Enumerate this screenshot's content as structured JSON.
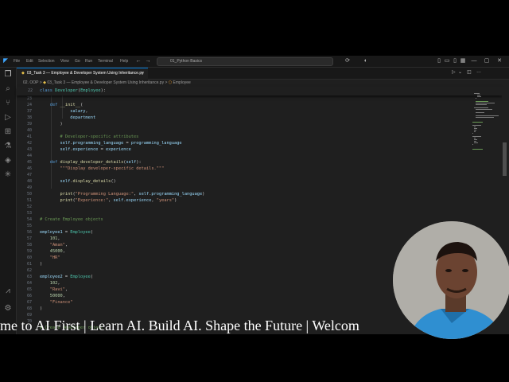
{
  "menu": [
    "File",
    "Edit",
    "Selection",
    "View",
    "Go",
    "Run",
    "Terminal",
    "Help"
  ],
  "search_text": "01_Python Basics",
  "tab": {
    "label": "03_Task 3 — Employee & Developer System Using Inheritance.py",
    "close": "×"
  },
  "breadcrumb": {
    "p1": "02. OOP",
    "sep": ">",
    "p2": "03_Task 3 — Employee & Developer System Using Inheritance.py",
    "p3": "Employee"
  },
  "sticky": {
    "ln": "22",
    "code": "class Developer(Employee):"
  },
  "lines": [
    {
      "n": "23",
      "t": ""
    },
    {
      "n": "24",
      "t": "    def __init__("
    },
    {
      "n": "37",
      "t": "            salary,"
    },
    {
      "n": "38",
      "t": "            department"
    },
    {
      "n": "39",
      "t": "        )"
    },
    {
      "n": "40",
      "t": ""
    },
    {
      "n": "41",
      "t": "        # Developer-specific attributes"
    },
    {
      "n": "42",
      "t": "        self.programming_language = programming_language"
    },
    {
      "n": "43",
      "t": "        self.experience = experience"
    },
    {
      "n": "44",
      "t": ""
    },
    {
      "n": "45",
      "t": "    def display_developer_details(self):"
    },
    {
      "n": "46",
      "t": "        \"\"\"Display developer-specific details.\"\"\""
    },
    {
      "n": "47",
      "t": ""
    },
    {
      "n": "48",
      "t": "        self.display_details()"
    },
    {
      "n": "49",
      "t": ""
    },
    {
      "n": "50",
      "t": "        print(\"Programming Language:\", self.programming_language)"
    },
    {
      "n": "51",
      "t": "        print(\"Experience:\", self.experience, \"years\")"
    },
    {
      "n": "52",
      "t": ""
    },
    {
      "n": "53",
      "t": ""
    },
    {
      "n": "54",
      "t": "# Create Employee objects"
    },
    {
      "n": "55",
      "t": ""
    },
    {
      "n": "56",
      "t": "employee1 = Employee("
    },
    {
      "n": "57",
      "t": "    101,"
    },
    {
      "n": "58",
      "t": "    \"Aman\","
    },
    {
      "n": "59",
      "t": "    45000,"
    },
    {
      "n": "60",
      "t": "    \"HR\""
    },
    {
      "n": "61",
      "t": ")"
    },
    {
      "n": "62",
      "t": ""
    },
    {
      "n": "63",
      "t": "employee2 = Employee("
    },
    {
      "n": "64",
      "t": "    102,"
    },
    {
      "n": "65",
      "t": "    \"Ravi\","
    },
    {
      "n": "66",
      "t": "    50000,"
    },
    {
      "n": "67",
      "t": "    \"Finance\""
    },
    {
      "n": "68",
      "t": ")"
    },
    {
      "n": "69",
      "t": ""
    },
    {
      "n": "70",
      "t": ""
    },
    {
      "n": "71",
      "t": "# Create Developer object"
    }
  ],
  "ticker": "me to AI First | Learn AI.  Build AI.  Shape the Future | Welcom",
  "colors": {
    "bg": "#1f1f1f",
    "accent": "#0078d4",
    "keyword": "#569cd6",
    "class": "#4ec9b0",
    "function": "#dcdcaa",
    "string": "#ce9178",
    "number": "#b5cea8",
    "comment": "#6a9955",
    "variable": "#9cdcfe"
  },
  "icons": {
    "app": "vscode-icon",
    "explorer": "files-icon",
    "search": "search-icon",
    "scm": "source-control-icon",
    "run": "run-debug-icon",
    "ext": "extensions-icon",
    "test": "testing-icon",
    "remote": "remote-icon",
    "settings": "gear-icon",
    "account": "account-icon"
  }
}
